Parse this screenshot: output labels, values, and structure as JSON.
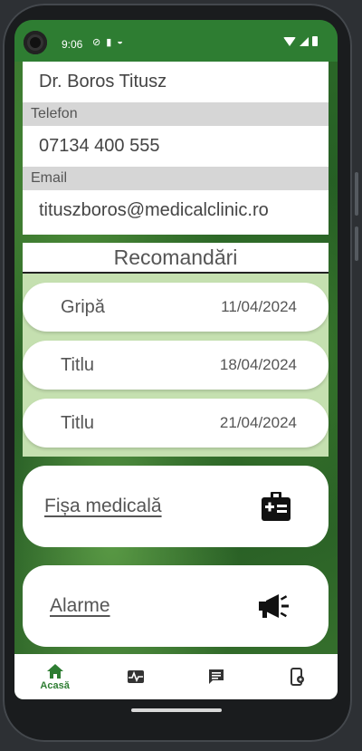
{
  "status_bar": {
    "time": "9:06"
  },
  "contact": {
    "name": "Dr. Boros Titusz",
    "phone_label": "Telefon",
    "phone": "07134 400 555",
    "email_label": "Email",
    "email": "tituszboros@medicalclinic.ro"
  },
  "recommendations": {
    "title": "Recomandări",
    "items": [
      {
        "title": "Gripă",
        "date": "11/04/2024"
      },
      {
        "title": "Titlu",
        "date": "18/04/2024"
      },
      {
        "title": "Titlu",
        "date": "21/04/2024"
      }
    ]
  },
  "actions": {
    "medical_record": "Fișa medicală",
    "alarms": "Alarme"
  },
  "nav": {
    "home_label": "Acasă",
    "accent_color": "#2e7d32"
  }
}
